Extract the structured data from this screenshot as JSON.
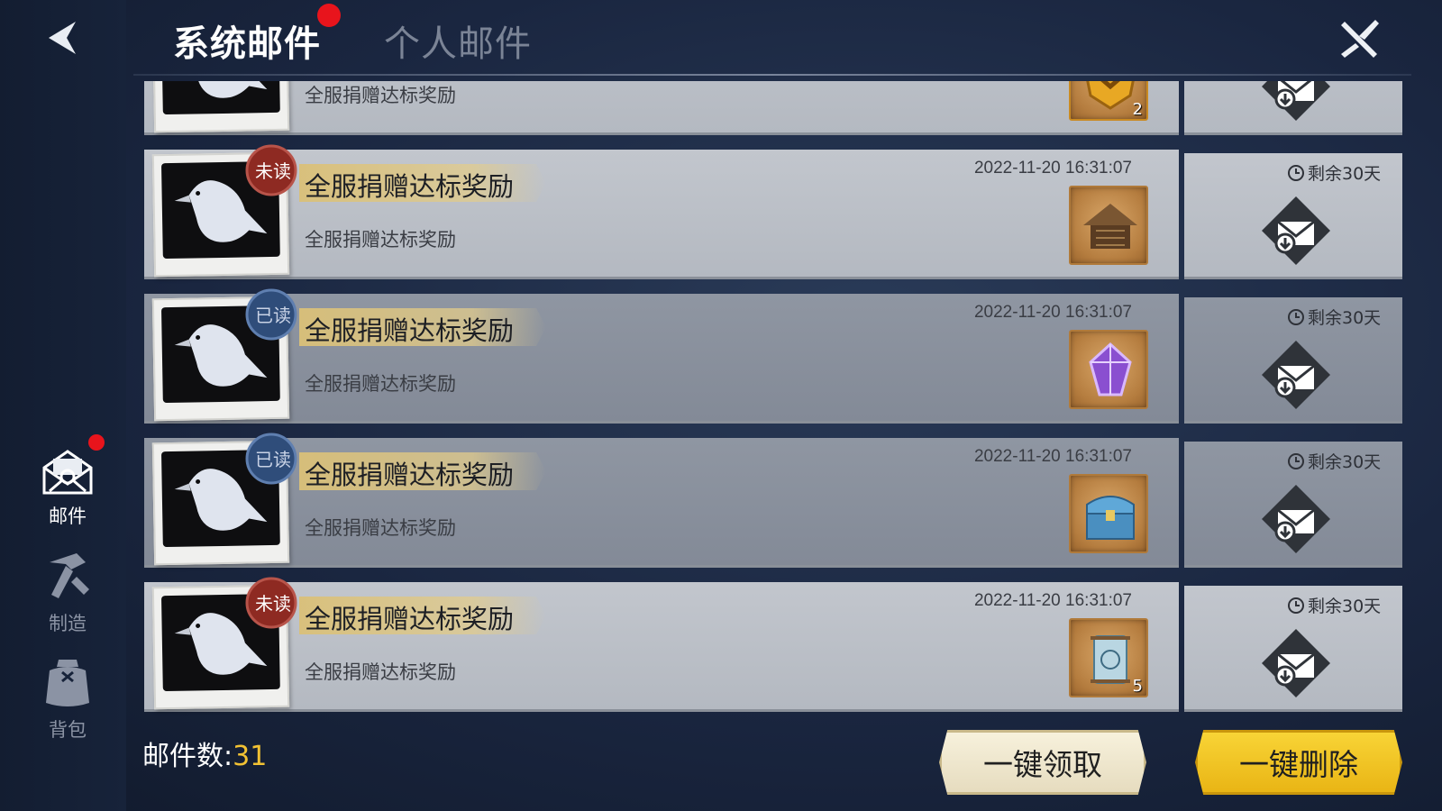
{
  "header": {
    "tabs": [
      {
        "label": "系统邮件",
        "active": true,
        "notification_dot": true
      },
      {
        "label": "个人邮件",
        "active": false
      }
    ]
  },
  "sidebar": {
    "items": [
      {
        "label": "邮件",
        "icon": "mail-icon",
        "active": true,
        "notification_dot": true
      },
      {
        "label": "制造",
        "icon": "hammer-icon",
        "active": false
      },
      {
        "label": "背包",
        "icon": "backpack-icon",
        "active": false
      }
    ]
  },
  "mails": [
    {
      "status": "",
      "title": "",
      "subtitle": "全服捐赠达标奖励",
      "date": "",
      "expire": "",
      "reward_icon": "gold-badge-icon",
      "reward_count": "2",
      "partial": true
    },
    {
      "status": "未读",
      "title": "全服捐赠达标奖励",
      "subtitle": "全服捐赠达标奖励",
      "date": "2022-11-20 16:31:07",
      "expire": "剩余30天",
      "reward_icon": "hut-icon",
      "reward_count": ""
    },
    {
      "status": "已读",
      "title": "全服捐赠达标奖励",
      "subtitle": "全服捐赠达标奖励",
      "date": "2022-11-20 16:31:07",
      "expire": "剩余30天",
      "reward_icon": "purple-crystal-icon",
      "reward_count": ""
    },
    {
      "status": "已读",
      "title": "全服捐赠达标奖励",
      "subtitle": "全服捐赠达标奖励",
      "date": "2022-11-20 16:31:07",
      "expire": "剩余30天",
      "reward_icon": "treasure-chest-icon",
      "reward_count": ""
    },
    {
      "status": "未读",
      "title": "全服捐赠达标奖励",
      "subtitle": "全服捐赠达标奖励",
      "date": "2022-11-20 16:31:07",
      "expire": "剩余30天",
      "reward_icon": "scroll-icon",
      "reward_count": "5"
    }
  ],
  "footer": {
    "count_label": "邮件数:",
    "count_value": "31",
    "claim_all_label": "一键领取",
    "delete_all_label": "一键删除"
  },
  "colors": {
    "unread_seal": "#8e2a22",
    "read_seal": "#2f4d7a",
    "accent_yellow": "#f2c233",
    "notification_red": "#e8141c"
  }
}
